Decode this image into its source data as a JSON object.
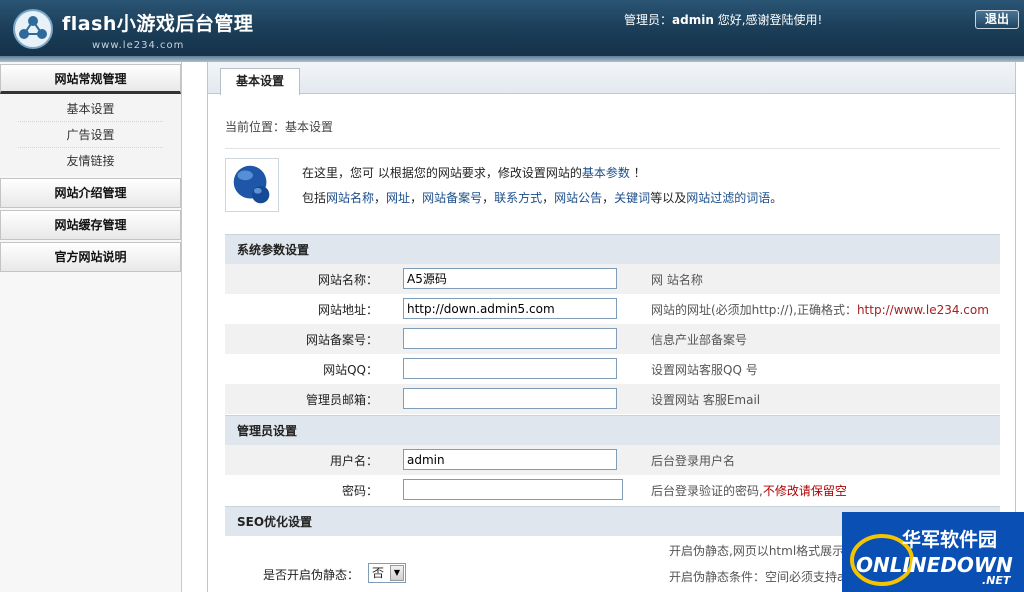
{
  "header": {
    "title": "flash小游戏后台管理",
    "url": "www.le234.com",
    "admin_prefix": "管理员：",
    "admin_name": "admin",
    "admin_suffix": " 您好,感谢登陆使用!",
    "logout_label": "退出"
  },
  "sidebar": {
    "groups": [
      {
        "label": "网站常规管理",
        "items": [
          {
            "label": "基本设置"
          },
          {
            "label": "广告设置"
          },
          {
            "label": "友情链接"
          }
        ]
      },
      {
        "label": "网站介绍管理"
      },
      {
        "label": "网站缓存管理"
      },
      {
        "label": "官方网站说明"
      }
    ]
  },
  "main": {
    "tab_label": "基本设置",
    "breadcrumb": "当前位置：基本设置",
    "intro": {
      "line1_a": "在这里，您可 以根据您的网站要求，修改设置网站的",
      "line1_link": "基本参数",
      "line1_b": " ！",
      "line2_prefix": "包括",
      "l_name": "网站名称",
      "l_url": "网址",
      "l_icp": "网站备案号",
      "l_contact": "联系方式",
      "l_notice": "网站公告",
      "l_keywords": "关键词",
      "line2_mid": "等以及",
      "l_filter": "网站过滤的词语",
      "line2_end": "。"
    },
    "sections": {
      "system": "系统参数设置",
      "admin": "管理员设置",
      "seo": "SEO优化设置"
    },
    "fields": {
      "site_name": {
        "label": "网站名称：",
        "value": "A5源码",
        "hint": "网 站名称"
      },
      "site_url": {
        "label": "网站地址：",
        "value": "http://down.admin5.com",
        "hint": "网站的网址(必须加http://),正确格式：",
        "hint_example": "http://www.le234.com"
      },
      "icp": {
        "label": "网站备案号：",
        "value": "",
        "hint": "信息产业部备案号"
      },
      "qq": {
        "label": "网站QQ：",
        "value": "",
        "hint": "设置网站客服QQ 号"
      },
      "email": {
        "label": "管理员邮箱：",
        "value": "",
        "hint": "设置网站 客服Email"
      },
      "username": {
        "label": "用户名：",
        "value": "admin",
        "hint": "后台登录用户名"
      },
      "password": {
        "label": "密码：",
        "value": "",
        "hint": "后台登录验证的密码,",
        "hint_red": "不修改请保留空"
      },
      "static": {
        "label": "是否开启伪静态：",
        "selected": "否",
        "hint1": "开启伪静态,网页以html格式展示,",
        "hint2": "开启伪静态条件：空间必须支持a"
      }
    }
  },
  "watermark": {
    "cn": "华军软件园",
    "en": "ONLINEDOWN",
    "suffix": ".NET"
  },
  "colors": {
    "header_bg": "#1c3f5a",
    "section_bg": "#dfe6ed",
    "link": "#1a4e8a",
    "warning_red": "#b00000"
  }
}
